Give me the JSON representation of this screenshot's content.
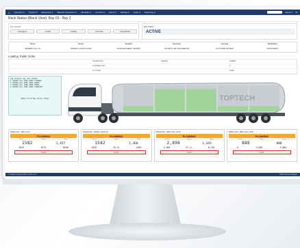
{
  "nav": {
    "items": [
      "Operation ▾",
      "Product ▾",
      "Equipment ▾",
      "Manual Transaction ▾",
      "Allocation ▾",
      "Contract ▾",
      "Admin ▾",
      "Settings ▾",
      "Users ▾",
      "Reporting ▾"
    ],
    "user": "Admin ▾"
  },
  "page": {
    "title": "Rack Status (Block View): Bay 01 - Bay 2"
  },
  "key_actions": {
    "label": "Key Actions",
    "buttons": [
      "Unassigned",
      "Locked",
      "Loading",
      "Auto Start",
      "Stop Manual"
    ]
  },
  "bay_status": {
    "label": "Bay Status",
    "value": "ACTIVE"
  },
  "info": {
    "headers": [
      "Driver",
      "Carrier",
      "Supplier",
      "Customer",
      "Account",
      "Destination"
    ],
    "values": [
      "BRN0983 | Tracy Jon",
      "TRANSPO LOGISTICS GRP",
      "SUPPLIER ENERGY TRADING",
      "TOPTECH FUEL CUSTOMER 001",
      "ACCT-20398-TOPTECH",
      "NORTH DEPOT"
    ],
    "extra": "Order"
  },
  "loading": {
    "title": "Loading Trailer Order",
    "rows": [
      [
        "",
        "Compartment",
        "Capacity",
        "Loaded"
      ],
      [
        "",
        "Cl: 0 Start Limit",
        "",
        "0"
      ],
      [
        "",
        "Cl: 0 Total",
        "",
        "5,000"
      ]
    ]
  },
  "compartments": {
    "header": [
      "Cmp",
      "Product",
      "Qty",
      "Prd",
      "Status"
    ],
    "rows": [
      [
        "1",
        "DIESEL ULS",
        "1000",
        "PROD",
        "FLOWING"
      ],
      [
        "2",
        "DIESEL ULS",
        "1000",
        "PROD",
        "READY"
      ],
      [
        "3",
        "DIESEL ULS",
        "1000",
        "PROD",
        "READY"
      ],
      [
        "4",
        "DIESEL ULS",
        "1000",
        "PROD",
        "COMPLETE"
      ]
    ],
    "footer": "Meter Print Bay Driver Shows"
  },
  "truck": {
    "brand": "TOPTECH",
    "fills": [
      0.2,
      0.85,
      0.85,
      0.2,
      0.2
    ],
    "colors": {
      "empty": "#c9ccd1",
      "full": "#9fd49a",
      "tank": "#d3d6da"
    }
  },
  "meters": [
    {
      "title": "PM01C01 - BRC P10",
      "status": "FLOWING",
      "h": [
        "Preset",
        "Gross",
        "Temp"
      ],
      "big": "1582",
      "small": "1,457",
      "sub": [
        "3025",
        "8774",
        "8540"
      ],
      "stop": "STOP"
    },
    {
      "title": "PM01C02 - PR89 / AURUS",
      "status": "FLOWING",
      "h": [
        "Preset",
        "Gross",
        "Temp"
      ],
      "big": "1582",
      "small": "1,360",
      "sub": [
        "1020",
        "35.5+",
        "2055"
      ],
      "stop": "STOP"
    },
    {
      "title": "PM01C03 - BRC P11 / P15",
      "status": "FLOWING",
      "h": [
        "Preset",
        "Gross",
        "Temp"
      ],
      "big": "2,896",
      "small": "1,343",
      "sub": [
        "5,002",
        "57.2+",
        "8,140"
      ],
      "stop": "STOP"
    },
    {
      "title": "PM01C04 - BRC P10 / P15",
      "status": "FLOWING",
      "h": [
        "Preset",
        "Gross",
        "Temp"
      ],
      "big": "888",
      "small": "888",
      "sub": [
        "0",
        "5.005",
        "6,880"
      ],
      "stop": "STOP"
    }
  ],
  "footer": {
    "left": "© Toptech Systems 2019 | Version 10.1",
    "right": "TMS6 Terminal Manager"
  }
}
